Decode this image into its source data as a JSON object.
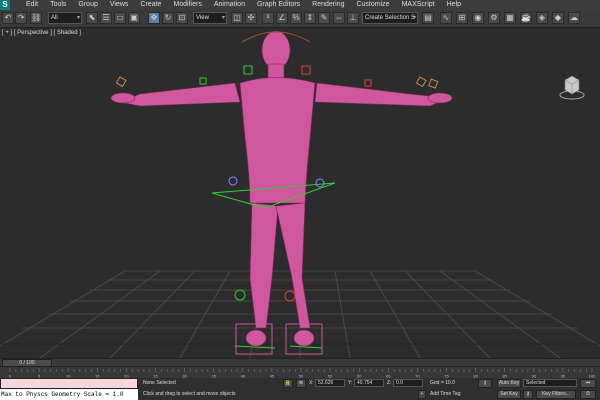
{
  "app": {
    "logo_text": "S"
  },
  "menu": [
    "Edit",
    "Tools",
    "Group",
    "Views",
    "Create",
    "Modifiers",
    "Animation",
    "Graph Editors",
    "Rendering",
    "Customize",
    "MAXScript",
    "Help"
  ],
  "toolbar": {
    "undo_icon": "undo-icon",
    "redo_icon": "redo-icon",
    "selection_filter": "All",
    "reference_coord": "View",
    "named_selection_sets": "Create Selection S"
  },
  "viewport": {
    "label": "[ + ] [ Perspective ] [ Shaded ]",
    "background": "#2c2c2c",
    "grid_color": "#505050",
    "model_color": "#d0569e"
  },
  "timeslider": {
    "counter": "0 / 100"
  },
  "trackbar": {
    "ticks": [
      "0",
      "5",
      "10",
      "15",
      "20",
      "25",
      "30",
      "35",
      "40",
      "45",
      "50",
      "55",
      "60",
      "65",
      "70",
      "75",
      "80",
      "85",
      "90",
      "95",
      "100"
    ]
  },
  "status": {
    "listener_output": "Max to Physcs Geometry Scale = 1.0",
    "selection_count": "None Selected",
    "prompt": "Click and drag to select and move objects",
    "x_label": "X:",
    "x_value": "52.626",
    "y_label": "Y:",
    "y_value": "40.754",
    "z_label": "Z:",
    "z_value": "0.0",
    "grid": "Grid = 10.0",
    "add_time_tag": "Add Time Tag",
    "auto_key": "Auto Key",
    "set_key": "Set Key",
    "key_filters": "Key Filters...",
    "key_mode": "Selected"
  }
}
